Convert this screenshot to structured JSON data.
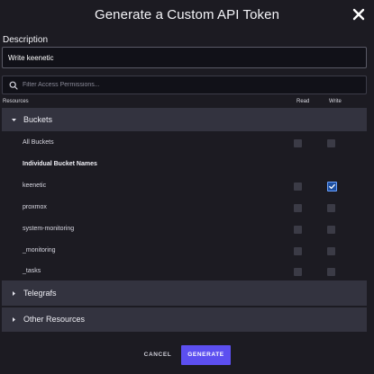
{
  "dialog": {
    "title": "Generate a Custom API Token"
  },
  "description": {
    "label": "Description",
    "value": "Write keenetic"
  },
  "filter": {
    "placeholder": "Filter Access Permissions..."
  },
  "columns": {
    "resources": "Resources",
    "read": "Read",
    "write": "Write"
  },
  "sections": {
    "buckets": {
      "label": "Buckets",
      "expanded": true
    },
    "telegrafs": {
      "label": "Telegrafs",
      "expanded": false
    },
    "other": {
      "label": "Other Resources",
      "expanded": false
    }
  },
  "buckets": {
    "all_label": "All Buckets",
    "individual_heading": "Individual Bucket Names",
    "items": [
      {
        "name": "keenetic",
        "read": false,
        "write": true
      },
      {
        "name": "proxmox",
        "read": false,
        "write": false
      },
      {
        "name": "system-monitoring",
        "read": false,
        "write": false
      },
      {
        "name": "_monitoring",
        "read": false,
        "write": false
      },
      {
        "name": "_tasks",
        "read": false,
        "write": false
      }
    ]
  },
  "footer": {
    "cancel_label": "CANCEL",
    "generate_label": "GENERATE"
  },
  "colors": {
    "accent": "#5c4ff0",
    "check": "#6aa1ff",
    "background": "#1c1b22",
    "section": "#33333f"
  },
  "icons": {
    "close": "close-icon",
    "search": "search-icon",
    "caret": "caret-icon",
    "check": "check-icon"
  }
}
